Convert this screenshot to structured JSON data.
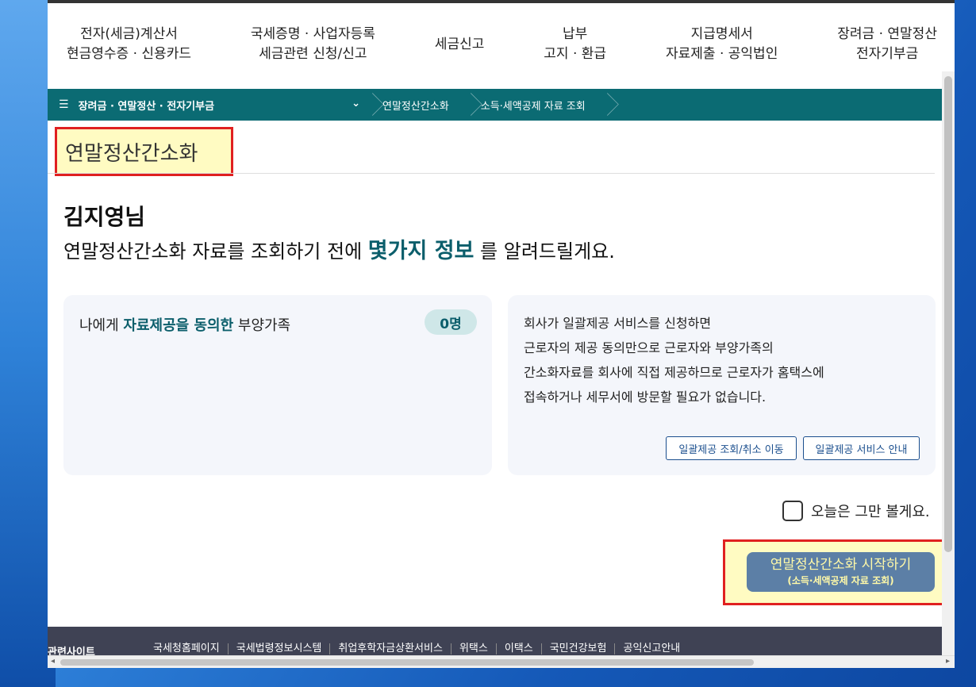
{
  "topnav": {
    "items": [
      {
        "line1": "전자(세금)계산서",
        "line2": "현금영수증 · 신용카드"
      },
      {
        "line1": "국세증명 · 사업자등록",
        "line2": "세금관련 신청/신고"
      },
      {
        "line1": "세금신고",
        "line2": ""
      },
      {
        "line1": "납부",
        "line2": "고지 · 환급"
      },
      {
        "line1": "지급명세서",
        "line2": "자료제출 · 공익법인"
      },
      {
        "line1": "장려금 · 연말정산",
        "line2": "전자기부금"
      }
    ]
  },
  "breadcrumb": {
    "menu_label": "장려금 · 연말정산 · 전자기부금",
    "items": [
      "연말정산간소화",
      "소득·세액공제 자료 조회"
    ]
  },
  "page": {
    "title": "연말정산간소화",
    "user_name": "김지영님",
    "intro_before": "연말정산간소화 자료를 조회하기 전에 ",
    "intro_highlight": "몇가지 정보",
    "intro_after": " 를 알려드릴게요."
  },
  "consent_card": {
    "label_before": "나에게 ",
    "label_highlight": "자료제공을 동의한",
    "label_after": " 부양가족",
    "count": "0명"
  },
  "info_card": {
    "lines": [
      "회사가 일괄제공 서비스를 신청하면",
      "근로자의 제공 동의만으로 근로자와 부양가족의",
      "간소화자료를 회사에 직접 제공하므로 근로자가 홈택스에",
      "접속하거나 세무서에 방문할 필요가 없습니다."
    ],
    "btn_inquiry": "일괄제공 조회/취소 이동",
    "btn_guide": "일괄제공 서비스 안내"
  },
  "today_check": "오늘은 그만 볼게요.",
  "start_button": {
    "main": "연말정산간소화 시작하기",
    "sub": "(소득·세액공제 자료 조회)"
  },
  "footer": {
    "title": "관련사이트",
    "links": [
      "국세청홈페이지",
      "국세법령정보시스템",
      "취업후학자금상환서비스",
      "위택스",
      "이택스",
      "국민건강보험",
      "공익신고안내"
    ]
  },
  "colors": {
    "teal": "#0b6b73",
    "highlight_text": "#0b5e6b",
    "annotation_red": "#e02020",
    "annotation_fill": "#fffbc2"
  }
}
